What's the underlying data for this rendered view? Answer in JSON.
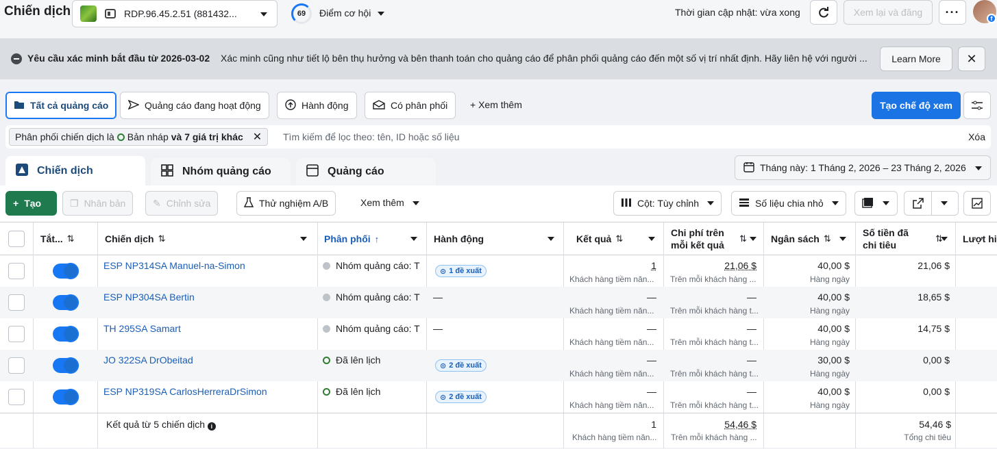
{
  "header": {
    "title": "Chiến dịch",
    "account_name": "RDP.96.45.2.51 (881432...",
    "score": "69",
    "opportunity_label": "Điểm cơ hội",
    "update_time": "Thời gian cập nhật: vừa xong",
    "review_publish": "Xem lại và đăng",
    "more": "···"
  },
  "banner": {
    "title": "Yêu cầu xác minh bắt đầu từ 2026-03-02",
    "body": "Xác minh cũng như tiết lộ bên thụ hưởng và bên thanh toán cho quảng cáo để phân phối quảng cáo đến một số vị trí nhất định. Hãy liên hệ với người ...",
    "learn_more": "Learn More",
    "close": "✕"
  },
  "filters": {
    "all_ads": "Tất cả quảng cáo",
    "active_ads": "Quảng cáo đang hoạt động",
    "actions": "Hành động",
    "delivering": "Có phân phối",
    "see_more": "+ Xem thêm",
    "create_view": "Tạo chế độ xem"
  },
  "search": {
    "chip_prefix": "Phân phối chiến dịch là",
    "chip_value": "Bản nháp",
    "chip_more": "và 7 giá trị khác",
    "placeholder": "Tìm kiếm để lọc theo: tên, ID hoặc số liệu",
    "clear": "Xóa"
  },
  "tabs": [
    {
      "label": "Chiến dịch"
    },
    {
      "label": "Nhóm quảng cáo"
    },
    {
      "label": "Quảng cáo"
    }
  ],
  "date_range": "Tháng này: 1 Tháng 2, 2026 – 23 Tháng 2, 2026",
  "toolbar": {
    "create": "Tạo",
    "duplicate": "Nhân bản",
    "edit": "Chỉnh sửa",
    "ab_test": "Thử nghiệm A/B",
    "see_more": "Xem thêm",
    "columns": "Cột: Tùy chỉnh",
    "breakdown": "Số liệu chia nhỏ"
  },
  "table": {
    "headers": {
      "onoff": "Tắt...",
      "campaign": "Chiến dịch",
      "delivery": "Phân phối",
      "actions": "Hành động",
      "results": "Kết quả",
      "cpr": "Chi phí trên mỗi kết quả",
      "budget": "Ngân sách",
      "spent": "Số tiền đã chi tiêu",
      "reach": "Lượt hiể"
    },
    "rows": [
      {
        "name": "ESP NP314SA Manuel-na-Simon",
        "delivery": "Nhóm quảng cáo: T",
        "action": "1 đề xuất",
        "results": "1",
        "results_sub": "Khách hàng tiềm năn...",
        "cpr": "21,06 $",
        "cpr_sub": "Trên mỗi khách hàng ...",
        "budget": "40,00 $",
        "budget_sub": "Hàng ngày",
        "spent": "21,06 $"
      },
      {
        "name": "ESP NP304SA Bertin",
        "delivery": "Nhóm quảng cáo: T",
        "action": "—",
        "results": "—",
        "results_sub": "Khách hàng tiềm năn...",
        "cpr": "—",
        "cpr_sub": "Trên mỗi khách hàng t...",
        "budget": "40,00 $",
        "budget_sub": "Hàng ngày",
        "spent": "18,65 $"
      },
      {
        "name": "TH 295SA Samart",
        "delivery": "Nhóm quảng cáo: T",
        "action": "—",
        "results": "—",
        "results_sub": "Khách hàng tiềm năn...",
        "cpr": "—",
        "cpr_sub": "Trên mỗi khách hàng t...",
        "budget": "40,00 $",
        "budget_sub": "Hàng ngày",
        "spent": "14,75 $"
      },
      {
        "name": "JO 322SA DrObeitad",
        "delivery": "Đã lên lịch",
        "action": "2 đề xuất",
        "results": "—",
        "results_sub": "Khách hàng tiềm năn...",
        "cpr": "—",
        "cpr_sub": "Trên mỗi khách hàng t...",
        "budget": "30,00 $",
        "budget_sub": "Hàng ngày",
        "spent": "0,00 $"
      },
      {
        "name": "ESP NP319SA CarlosHerreraDrSimon",
        "delivery": "Đã lên lịch",
        "action": "2 đề xuất",
        "results": "—",
        "results_sub": "Khách hàng tiềm năn...",
        "cpr": "—",
        "cpr_sub": "Trên mỗi khách hàng t...",
        "budget": "40,00 $",
        "budget_sub": "Hàng ngày",
        "spent": "0,00 $"
      }
    ],
    "footer": {
      "label": "Kết quả từ 5 chiến dịch",
      "results": "1",
      "results_sub": "Khách hàng tiềm năn...",
      "cpr": "54,46 $",
      "cpr_sub": "Trên mỗi khách hàng ...",
      "spent": "54,46 $",
      "spent_sub": "Tổng chi tiêu"
    }
  }
}
